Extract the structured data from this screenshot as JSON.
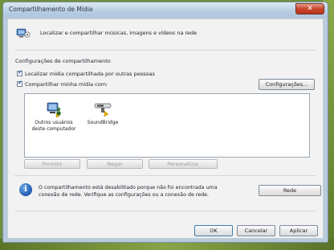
{
  "window": {
    "title": "Compartilhamento de Mídia"
  },
  "intro": {
    "text": "Localizar e compartilhar músicas, imagens e vídeos na rede"
  },
  "settings": {
    "section_label": "Configurações de compartilhamento",
    "checkbox_find": {
      "label": "Localizar mídia compartilhada por outras pessoas",
      "checked": true
    },
    "checkbox_share": {
      "label": "Compartilhar minha mídia com:",
      "checked": true
    },
    "configure_button": "Configurações..."
  },
  "devices": [
    {
      "label_line1": "Outros usuários",
      "label_line2": "deste computador"
    },
    {
      "label_line1": "SoundBridge",
      "label_line2": ""
    }
  ],
  "device_actions": {
    "allow": "Permitir",
    "deny": "Negar",
    "customize": "Personalizar"
  },
  "info": {
    "text": "O compartilhamento está desabilitado porque não foi encontrada uma conexão de rede. Verifique as configurações ou a conexão de rede.",
    "network_button": "Rede"
  },
  "footer": {
    "ok": "OK",
    "cancel": "Cancelar",
    "apply": "Aplicar"
  },
  "colors": {
    "desktop": "#6f8f3a",
    "titlebar": "#b9cfe2",
    "close": "#c9442a",
    "info_icon": "#1f5ab0"
  }
}
